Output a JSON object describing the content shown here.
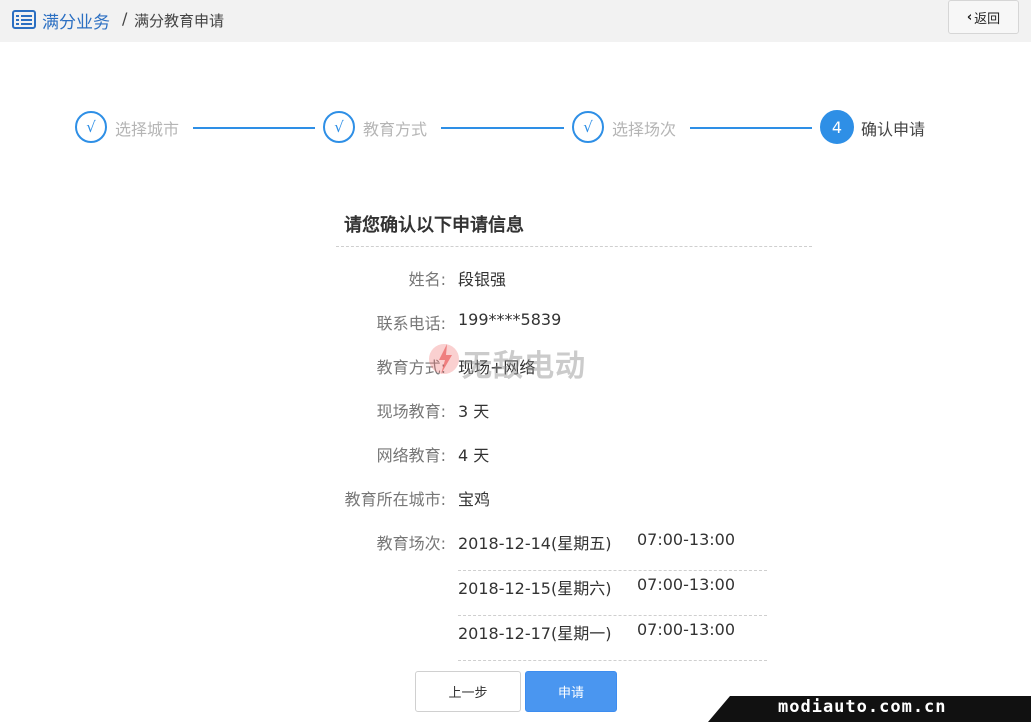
{
  "header": {
    "icon": "list-icon",
    "breadcrumb_link": "满分业务",
    "breadcrumb_separator": "/",
    "breadcrumb_current": "满分教育申请",
    "back_label": "返回"
  },
  "steps": [
    {
      "marker": "√",
      "label": "选择城市",
      "state": "done"
    },
    {
      "marker": "√",
      "label": "教育方式",
      "state": "done"
    },
    {
      "marker": "√",
      "label": "选择场次",
      "state": "done"
    },
    {
      "marker": "4",
      "label": "确认申请",
      "state": "active"
    }
  ],
  "confirm": {
    "title": "请您确认以下申请信息",
    "fields": [
      {
        "label": "姓名:",
        "value": "段银强"
      },
      {
        "label": "联系电话:",
        "value": "199****5839"
      },
      {
        "label": "教育方式:",
        "value": "现场+网络"
      },
      {
        "label": "现场教育:",
        "value": "3 天"
      },
      {
        "label": "网络教育:",
        "value": "4 天"
      },
      {
        "label": "教育所在城市:",
        "value": "宝鸡"
      }
    ],
    "sessions_label": "教育场次:",
    "sessions": [
      {
        "date": "2018-12-14(星期五)",
        "time": "07:00-13:00"
      },
      {
        "date": "2018-12-15(星期六)",
        "time": "07:00-13:00"
      },
      {
        "date": "2018-12-17(星期一)",
        "time": "07:00-13:00"
      }
    ]
  },
  "actions": {
    "prev_label": "上一步",
    "apply_label": "申请"
  },
  "watermark": {
    "center_text": "无敌电动",
    "corner_text": "modiauto.com.cn"
  },
  "colors": {
    "accent": "#2e8fe6",
    "link": "#2b6fc2",
    "button_primary": "#4a96f0"
  }
}
